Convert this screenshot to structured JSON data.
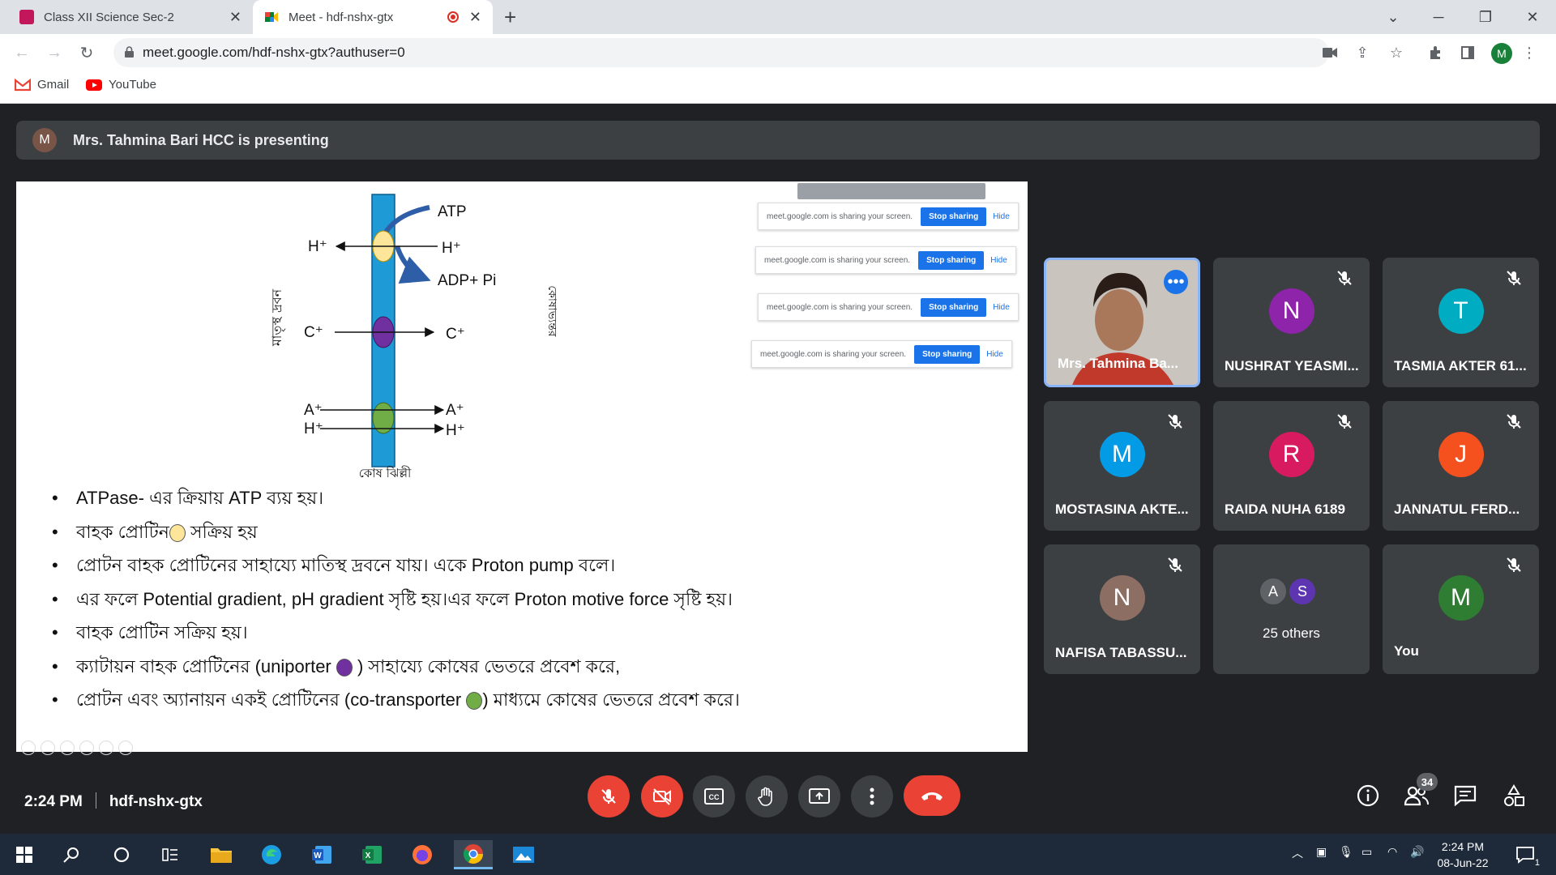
{
  "browser": {
    "tabs": [
      {
        "title": "Class XII Science Sec-2",
        "active": false
      },
      {
        "title": "Meet - hdf-nshx-gtx",
        "active": true
      }
    ],
    "url": "meet.google.com/hdf-nshx-gtx?authuser=0",
    "profile_initial": "M",
    "bookmarks": [
      {
        "label": "Gmail"
      },
      {
        "label": "YouTube"
      }
    ]
  },
  "meet": {
    "presenter_initial": "M",
    "presenting_text": "Mrs. Tahmina Bari HCC is presenting",
    "meeting_time": "2:24 PM",
    "meeting_code": "hdf-nshx-gtx",
    "participant_count": "34",
    "others_label": "25 others",
    "others_initials": [
      "A",
      "S"
    ],
    "tiles": [
      {
        "name": "Mrs. Tahmina Ba...",
        "initial": "",
        "color": "",
        "muted": false,
        "video": true
      },
      {
        "name": "NUSHRAT YEASMI...",
        "initial": "N",
        "color": "#8e24aa",
        "muted": true
      },
      {
        "name": "TASMIA AKTER 61...",
        "initial": "T",
        "color": "#00acc1",
        "muted": true
      },
      {
        "name": "MOSTASINA AKTE...",
        "initial": "M",
        "color": "#039be5",
        "muted": true
      },
      {
        "name": "RAIDA NUHA 6189",
        "initial": "R",
        "color": "#d81b60",
        "muted": true
      },
      {
        "name": "JANNATUL FERD...",
        "initial": "J",
        "color": "#f4511e",
        "muted": true
      },
      {
        "name": "NAFISA TABASSU...",
        "initial": "N",
        "color": "#8d6e63",
        "muted": true
      },
      {
        "name": "You",
        "initial": "M",
        "color": "#2e7d32",
        "muted": true
      }
    ]
  },
  "slide": {
    "diagram": {
      "atp": "ATP",
      "adp": "ADP+ Pi",
      "h_plus": "H⁺",
      "c_plus": "C⁺",
      "a_plus": "A⁺",
      "left_label": "মাতৃস্থ দ্রবন",
      "right_label": "কোষাভ্যন্তর",
      "membrane_label": "কোষ ঝিল্লী"
    },
    "share_notice": "meet.google.com is sharing your screen.",
    "stop_sharing": "Stop sharing",
    "hide": "Hide",
    "bullets": [
      {
        "text": "ATPase- এর ক্রিয়ায় ATP ব্যয় হয়।"
      },
      {
        "before": "বাহক প্রোটিন",
        "after": " সক্রিয় হয়",
        "dot": "y"
      },
      {
        "text": "প্রোটন বাহক প্রোটিনের সাহায্যে মাতিস্থ দ্রবনে যায়। একে Proton pump বলে।"
      },
      {
        "text": "এর ফলে Potential gradient, pH gradient সৃষ্টি হয়।এর ফলে Proton motive force সৃষ্টি হয়।"
      },
      {
        "text": "বাহক প্রোটিন সক্রিয় হয়।"
      },
      {
        "before": "ক্যাটায়ন বাহক প্রোটিনের (uniporter ",
        "after": " ) সাহায্যে কোষের ভেতরে প্রবেশ করে,",
        "dot": "p"
      },
      {
        "before": "প্রোটন এবং অ্যানায়ন একই প্রোটিনের (co-transporter ",
        "after": ") মাধ্যমে কোষের ভেতরে প্রবেশ করে।",
        "dot": "g"
      }
    ]
  },
  "taskbar": {
    "time": "2:24 PM",
    "date": "08-Jun-22",
    "notification_count": "1"
  },
  "colors": {
    "meet_bg": "#202124",
    "tile_bg": "#3c4043",
    "end_call": "#ea4335",
    "accent": "#1a73e8",
    "membrane": "#1e9bd7"
  }
}
